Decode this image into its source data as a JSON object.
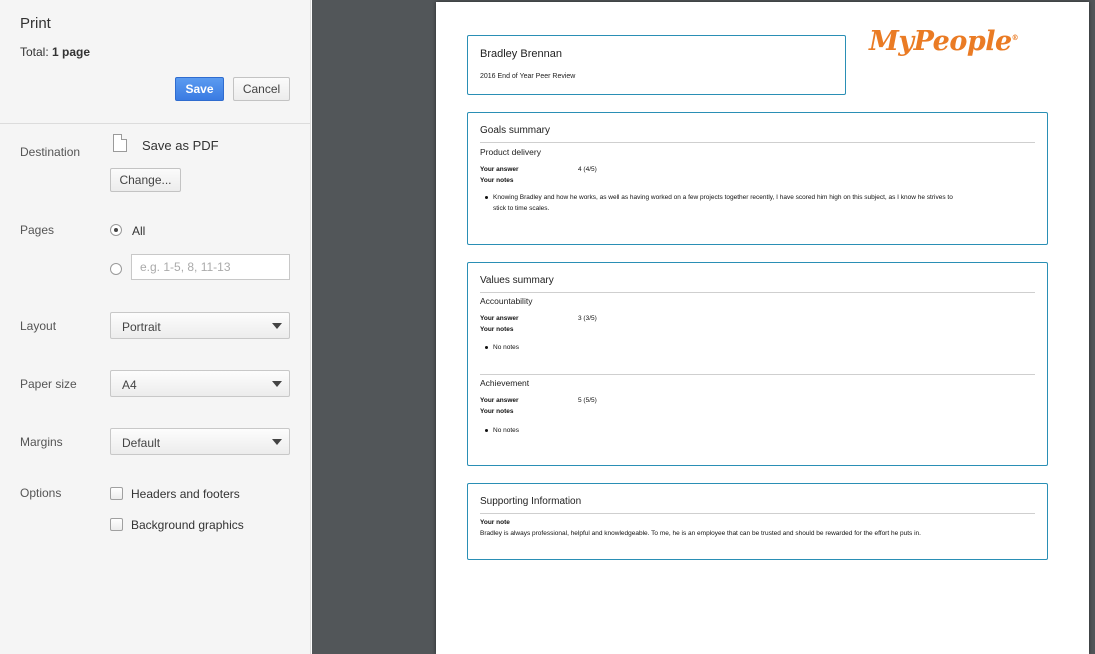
{
  "dialog": {
    "title": "Print",
    "total_label": "Total:",
    "total_value": "1 page",
    "save_label": "Save",
    "cancel_label": "Cancel"
  },
  "settings": {
    "destination": {
      "label": "Destination",
      "value": "Save as PDF",
      "change_label": "Change..."
    },
    "pages": {
      "label": "Pages",
      "all_label": "All",
      "selected": "All",
      "custom_placeholder": "e.g. 1-5, 8, 11-13",
      "custom_value": ""
    },
    "layout": {
      "label": "Layout",
      "value": "Portrait"
    },
    "paper_size": {
      "label": "Paper size",
      "value": "A4"
    },
    "margins": {
      "label": "Margins",
      "value": "Default"
    },
    "options": {
      "label": "Options",
      "headers_footers": {
        "label": "Headers and footers",
        "checked": false
      },
      "background_graphics": {
        "label": "Background graphics",
        "checked": false
      }
    }
  },
  "document": {
    "name": "Bradley Brennan",
    "subtitle": "2016 End of Year Peer Review",
    "logo_text": "MyPeople",
    "logo_color": "#ea7b24",
    "border_color": "#2a8fb5",
    "goals": {
      "title": "Goals summary",
      "items": [
        {
          "name": "Product delivery",
          "answer_label": "Your answer",
          "answer_value": "4 (4/5)",
          "notes_label": "Your notes",
          "note_line1": "Knowing Bradley and how he works, as well as having worked on a few projects together recently, I have scored him high on this subject, as I know he strives to",
          "note_line2": "stick to time scales."
        }
      ]
    },
    "values": {
      "title": "Values summary",
      "items": [
        {
          "name": "Accountability",
          "answer_label": "Your answer",
          "answer_value": "3 (3/5)",
          "notes_label": "Your notes",
          "note": "No notes"
        },
        {
          "name": "Achievement",
          "answer_label": "Your answer",
          "answer_value": "5 (5/5)",
          "notes_label": "Your notes",
          "note": "No notes"
        }
      ]
    },
    "supporting": {
      "title": "Supporting Information",
      "note_label": "Your note",
      "note": "Bradley is always professional, helpful and knowledgeable. To me, he is an employee that can be trusted and should be rewarded for the effort he puts in."
    }
  }
}
